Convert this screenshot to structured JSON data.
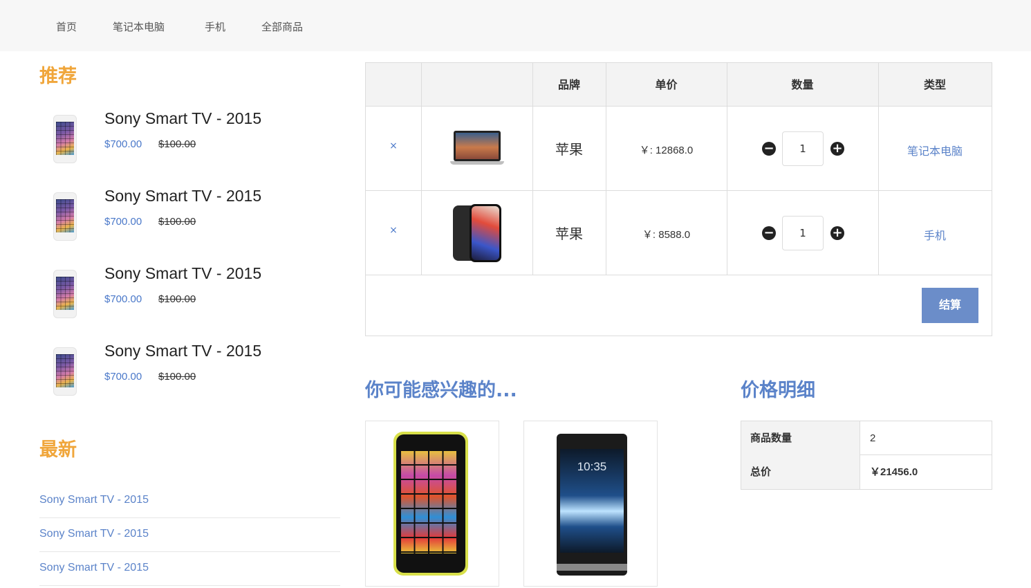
{
  "nav": {
    "items": [
      "首页",
      "笔记本电脑",
      "手机",
      "全部商品"
    ]
  },
  "recommend": {
    "title": "推荐",
    "items": [
      {
        "name": "Sony Smart TV - 2015",
        "price": "$700.00",
        "old_price": "$100.00"
      },
      {
        "name": "Sony Smart TV - 2015",
        "price": "$700.00",
        "old_price": "$100.00"
      },
      {
        "name": "Sony Smart TV - 2015",
        "price": "$700.00",
        "old_price": "$100.00"
      },
      {
        "name": "Sony Smart TV - 2015",
        "price": "$700.00",
        "old_price": "$100.00"
      }
    ]
  },
  "latest": {
    "title": "最新",
    "links": [
      "Sony Smart TV - 2015",
      "Sony Smart TV - 2015",
      "Sony Smart TV - 2015"
    ]
  },
  "cart": {
    "headers": [
      "",
      "",
      "品牌",
      "单价",
      "数量",
      "类型"
    ],
    "rows": [
      {
        "remove": "×",
        "image": "laptop-icon",
        "brand": "苹果",
        "price": "￥: 12868.0",
        "quantity": "1",
        "type": "笔记本电脑"
      },
      {
        "remove": "×",
        "image": "iphone-icon",
        "brand": "苹果",
        "price": "￥: 8588.0",
        "quantity": "1",
        "type": "手机"
      }
    ],
    "minus_icon": "minus-circle-icon",
    "plus_icon": "plus-circle-icon",
    "checkout_label": "结算"
  },
  "interests": {
    "title": "你可能感兴趣的...",
    "phone2_clock": "10:35"
  },
  "price_detail": {
    "title": "价格明细",
    "rows": [
      {
        "label": "商品数量",
        "value": "2"
      },
      {
        "label": "总价",
        "value": "￥21456.0"
      }
    ]
  },
  "colors": {
    "accent_orange": "#f0a63b",
    "link_blue": "#5b83c9",
    "button_blue": "#6b8dc9"
  }
}
